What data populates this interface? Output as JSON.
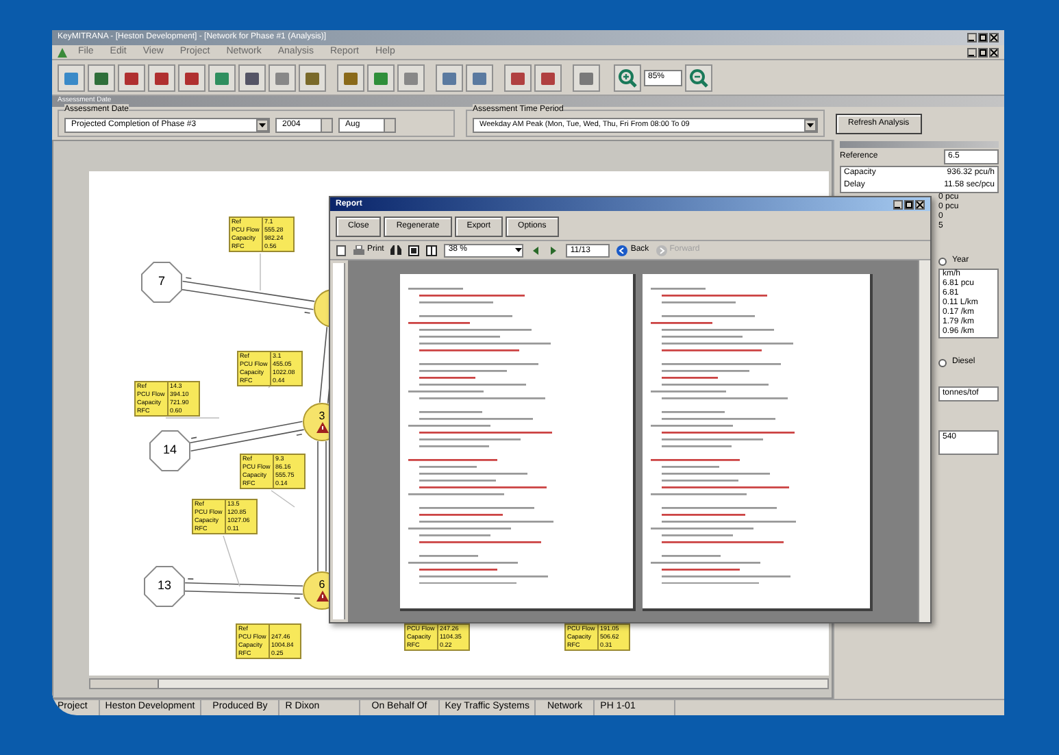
{
  "window": {
    "title": "KeyMITRANA - [Heston Development] - [Network for Phase #1 (Analysis)]"
  },
  "menu": [
    "File",
    "Edit",
    "View",
    "Project",
    "Network",
    "Analysis",
    "Report",
    "Help"
  ],
  "toolbar": {
    "zoom": "85%"
  },
  "assessment": {
    "header": "Assessment Date",
    "date_label": "Assessment Date",
    "date": "Projected Completion of Phase #3",
    "year": "2004",
    "month": "Aug",
    "period_label": "Assessment Time Period",
    "period": "Weekday AM Peak (Mon, Tue, Wed, Thu, Fri From 08:00 To 09",
    "refresh": "Refresh Analysis"
  },
  "network": {
    "nodes": [
      {
        "kind": "zone",
        "label": "7"
      },
      {
        "kind": "zone",
        "label": "14"
      },
      {
        "kind": "zone",
        "label": "13"
      },
      {
        "kind": "junction"
      },
      {
        "kind": "junction",
        "label": "3",
        "warning": true
      },
      {
        "kind": "junction",
        "label": "6",
        "warning": true
      }
    ],
    "links": [
      {
        "rows": [
          {
            "label": "Ref",
            "value": "7.1"
          },
          {
            "label": "PCU Flow",
            "value": "555.28"
          },
          {
            "label": "Capacity",
            "value": "982.24"
          },
          {
            "label": "RFC",
            "value": "0.56"
          }
        ]
      },
      {
        "rows": [
          {
            "label": "Ref",
            "value": "3.1"
          },
          {
            "label": "PCU Flow",
            "value": "455.05"
          },
          {
            "label": "Capacity",
            "value": "1022.08"
          },
          {
            "label": "RFC",
            "value": "0.44"
          }
        ]
      },
      {
        "rows": [
          {
            "label": "Ref",
            "value": "14.3"
          },
          {
            "label": "PCU Flow",
            "value": "394.10"
          },
          {
            "label": "Capacity",
            "value": "721.90"
          },
          {
            "label": "RFC",
            "value": "0.60"
          }
        ]
      },
      {
        "rows": [
          {
            "label": "Ref",
            "value": "9.3"
          },
          {
            "label": "PCU Flow",
            "value": "86.16"
          },
          {
            "label": "Capacity",
            "value": "555.75"
          },
          {
            "label": "RFC",
            "value": "0.14"
          }
        ]
      },
      {
        "rows": [
          {
            "label": "Ref",
            "value": "13.5"
          },
          {
            "label": "PCU Flow",
            "value": "120.85"
          },
          {
            "label": "Capacity",
            "value": "1027.06"
          },
          {
            "label": "RFC",
            "value": "0.11"
          }
        ]
      },
      {
        "rows": [
          {
            "label": "Ref"
          },
          {
            "label": "PCU Flow",
            "value": "247.46"
          },
          {
            "label": "Capacity",
            "value": "1004.84"
          },
          {
            "label": "RFC",
            "value": "0.25"
          }
        ]
      },
      {
        "rows": [
          {
            "label": "PCU Flow",
            "value": "247.26"
          },
          {
            "label": "Capacity",
            "value": "1104.35"
          },
          {
            "label": "RFC",
            "value": "0.22"
          }
        ]
      },
      {
        "rows": [
          {
            "label": "PCU Flow",
            "value": "191.05"
          },
          {
            "label": "Capacity",
            "value": "506.62"
          },
          {
            "label": "RFC",
            "value": "0.31"
          }
        ]
      }
    ]
  },
  "results": {
    "reference_label": "Reference",
    "reference": "6.5",
    "items": [
      {
        "name": "Capacity",
        "value": "936.32 pcu/h"
      },
      {
        "name": "Delay",
        "value": "11.58 sec/pcu"
      }
    ],
    "more_values": [
      "0 pcu",
      "0 pcu",
      "0",
      "5"
    ],
    "period_radio": {
      "label": "Year",
      "selected": false
    },
    "values": [
      "km/h",
      "6.81 pcu",
      "6.81",
      "0.11 L/km",
      "0.17 /km",
      "1.79 /km",
      "0.96 /km"
    ],
    "fuel_radio": {
      "label": "Diesel",
      "selected": false
    },
    "unit": "tonnes/tof",
    "total": "540"
  },
  "report": {
    "title": "Report",
    "buttons": [
      "Close",
      "Regenerate",
      "Export",
      "Options"
    ],
    "print": "Print",
    "zoom": "38 %",
    "page": "11/13",
    "back": {
      "label": "Back",
      "disabled": false
    },
    "forward": {
      "label": "Forward",
      "disabled": true
    }
  },
  "status_bar": [
    {
      "label": "Project",
      "value": "Heston Development"
    },
    {
      "label": "Produced By",
      "value": "R Dixon"
    },
    {
      "label": "On Behalf Of",
      "value": "Key Traffic Systems"
    },
    {
      "label": "Network",
      "value": "PH 1-01"
    }
  ]
}
